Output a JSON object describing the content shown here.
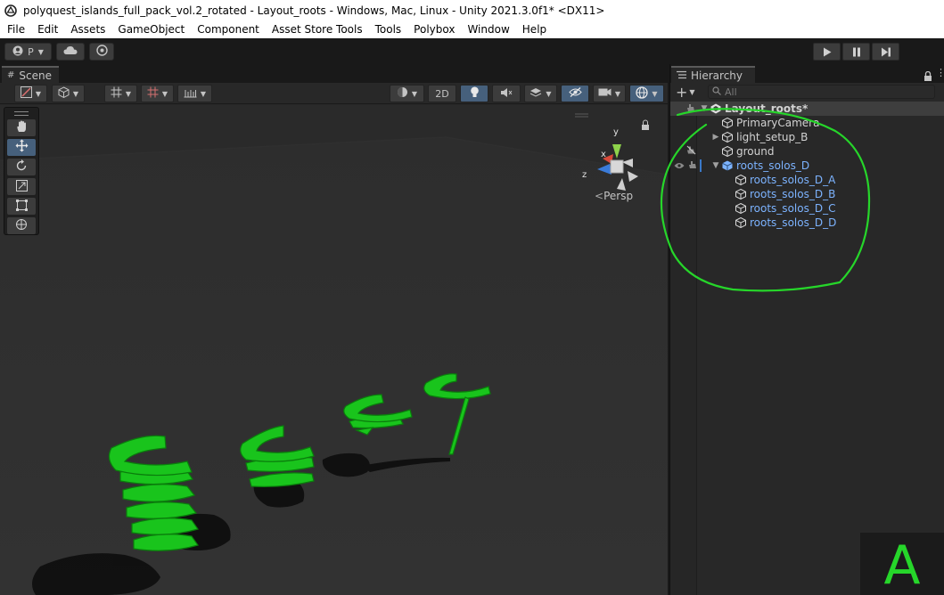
{
  "window": {
    "title": "polyquest_islands_full_pack_vol.2_rotated - Layout_roots - Windows, Mac, Linux - Unity 2021.3.0f1* <DX11>"
  },
  "menu": [
    "File",
    "Edit",
    "Assets",
    "GameObject",
    "Component",
    "Asset Store Tools",
    "Tools",
    "Polybox",
    "Window",
    "Help"
  ],
  "toolbar": {
    "account_label": "P"
  },
  "scene": {
    "tab_label": "Scene",
    "mode_2d_label": "2D",
    "projection_label": "Persp",
    "gizmo_axes": {
      "x": "x",
      "y": "y",
      "z": "z"
    }
  },
  "hierarchy": {
    "tab_label": "Hierarchy",
    "search_placeholder": "All",
    "root": "Layout_roots*",
    "items": [
      {
        "label": "PrimaryCamera",
        "depth": 1,
        "expandable": false,
        "highlight": false
      },
      {
        "label": "light_setup_B",
        "depth": 1,
        "expandable": true,
        "highlight": false
      },
      {
        "label": "ground",
        "depth": 1,
        "expandable": false,
        "highlight": false
      },
      {
        "label": "roots_solos_D",
        "depth": 1,
        "expandable": true,
        "expanded": true,
        "highlight": true
      },
      {
        "label": "roots_solos_D_A",
        "depth": 2,
        "expandable": false,
        "highlight": true
      },
      {
        "label": "roots_solos_D_B",
        "depth": 2,
        "expandable": false,
        "highlight": true
      },
      {
        "label": "roots_solos_D_C",
        "depth": 2,
        "expandable": false,
        "highlight": true
      },
      {
        "label": "roots_solos_D_D",
        "depth": 2,
        "expandable": false,
        "highlight": true
      }
    ]
  },
  "overlay": {
    "letter": "A"
  },
  "colors": {
    "annotation": "#26d62a",
    "selection_blue": "#7cb3ff",
    "active_tool": "#46607c"
  }
}
